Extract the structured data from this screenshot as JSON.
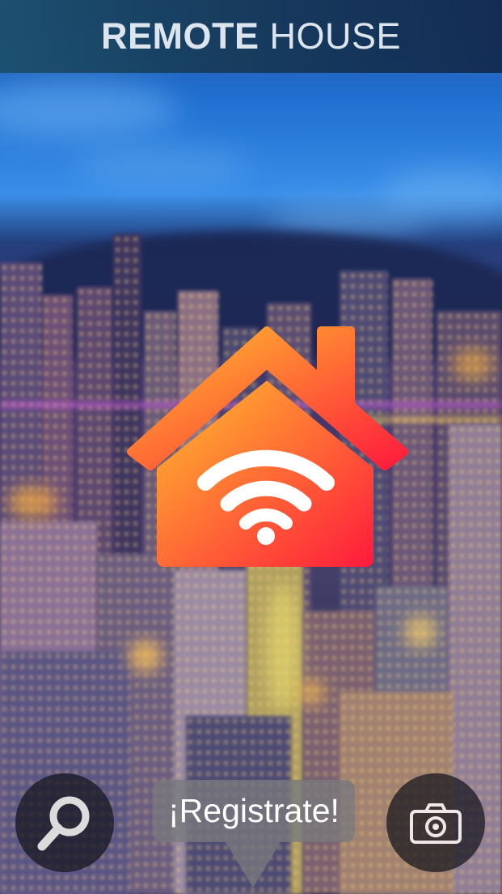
{
  "header": {
    "title_bold": "REMOTE",
    "title_light": "HOUSE"
  },
  "logo": {
    "icon": "house-wifi-icon",
    "colors": {
      "gradient_start": "#ffc02e",
      "gradient_end": "#ff1a3c",
      "wifi": "#ffffff"
    }
  },
  "actions": {
    "search_icon": "magnifier-icon",
    "register_label": "¡Registrate!",
    "camera_icon": "camera-icon"
  },
  "colors": {
    "header_bg": "#173b5a",
    "header_text": "#e8eef2",
    "button_bg": "#14141c",
    "bubble_bg": "#78787d"
  }
}
